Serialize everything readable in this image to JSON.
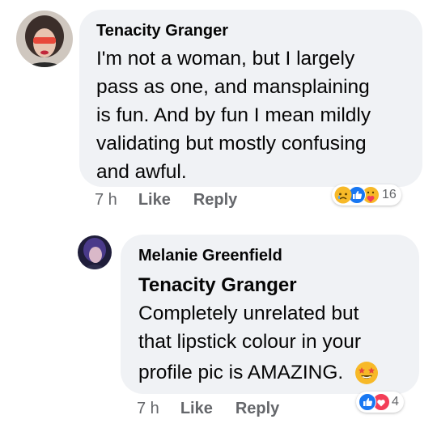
{
  "comment": {
    "author": "Tenacity Granger",
    "text_lines": [
      "I'm not a woman, but I largely",
      "pass as one, and mansplaining",
      "is fun. And by fun I mean mildly",
      "validating but mostly confusing",
      "and awful."
    ],
    "time": "7 h",
    "like_label": "Like",
    "reply_label": "Reply",
    "reactions": [
      "sad-face-icon",
      "like-thumb-icon",
      "care-hug-icon"
    ],
    "reaction_count": "16"
  },
  "reply": {
    "author": "Melanie Greenfield",
    "mention": "Tenacity Granger",
    "text_lines": [
      "Completely unrelated but",
      "that lipstick colour in your",
      "profile pic is AMAZING."
    ],
    "inline_emoji": "star-struck-icon",
    "time": "7 h",
    "like_label": "Like",
    "reply_label": "Reply",
    "reactions": [
      "like-thumb-icon",
      "love-heart-icon"
    ],
    "reaction_count": "4"
  },
  "colors": {
    "bubble": "#f0f2f5",
    "secondary_text": "#65676b",
    "like_blue": "#1877f2",
    "love_red": "#f33e58",
    "emoji_yellow": "#f7b928"
  }
}
